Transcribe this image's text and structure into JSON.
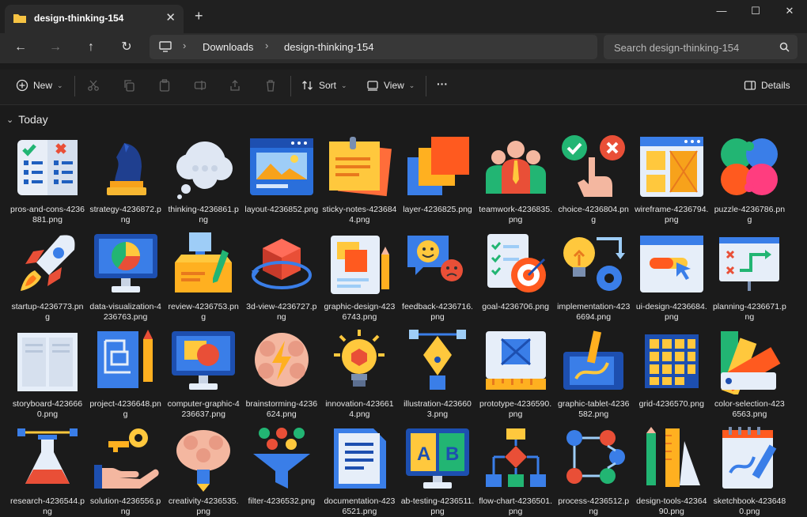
{
  "window": {
    "tab_title": "design-thinking-154",
    "minimize_glyph": "—",
    "maximize_glyph": "☐",
    "close_glyph": "✕"
  },
  "nav": {
    "breadcrumbs": [
      "Downloads",
      "design-thinking-154"
    ],
    "search_placeholder": "Search design-thinking-154"
  },
  "toolbar": {
    "new_label": "New",
    "sort_label": "Sort",
    "view_label": "View",
    "more_label": "···",
    "details_label": "Details"
  },
  "group_label": "Today",
  "files": [
    {
      "name": "pros-and-cons-4236881.png",
      "icon": "pros-cons-icon"
    },
    {
      "name": "strategy-4236872.png",
      "icon": "chess-knight-icon"
    },
    {
      "name": "thinking-4236861.png",
      "icon": "thought-cloud-icon"
    },
    {
      "name": "layout-4236852.png",
      "icon": "layout-window-icon"
    },
    {
      "name": "sticky-notes-4236844.png",
      "icon": "sticky-notes-icon"
    },
    {
      "name": "layer-4236825.png",
      "icon": "layers-icon"
    },
    {
      "name": "teamwork-4236835.png",
      "icon": "team-icon"
    },
    {
      "name": "choice-4236804.png",
      "icon": "choice-hand-icon"
    },
    {
      "name": "wireframe-4236794.png",
      "icon": "wireframe-icon"
    },
    {
      "name": "puzzle-4236786.png",
      "icon": "puzzle-brain-icon"
    },
    {
      "name": "startup-4236773.png",
      "icon": "rocket-icon"
    },
    {
      "name": "data-visualization-4236763.png",
      "icon": "pie-monitor-icon"
    },
    {
      "name": "review-4236753.png",
      "icon": "review-box-icon"
    },
    {
      "name": "3d-view-4236727.png",
      "icon": "cube-rotate-icon"
    },
    {
      "name": "graphic-design-4236743.png",
      "icon": "design-doc-icon"
    },
    {
      "name": "feedback-4236716.png",
      "icon": "feedback-faces-icon"
    },
    {
      "name": "goal-4236706.png",
      "icon": "goal-target-icon"
    },
    {
      "name": "implementation-4236694.png",
      "icon": "bulb-gear-icon"
    },
    {
      "name": "ui-design-4236684.png",
      "icon": "ui-design-icon"
    },
    {
      "name": "planning-4236671.png",
      "icon": "planning-board-icon"
    },
    {
      "name": "storyboard-4236660.png",
      "icon": "storyboard-icon"
    },
    {
      "name": "project-4236648.png",
      "icon": "blueprint-icon"
    },
    {
      "name": "computer-graphic-4236637.png",
      "icon": "computer-graphic-icon"
    },
    {
      "name": "brainstorming-4236624.png",
      "icon": "brain-bolt-icon"
    },
    {
      "name": "innovation-4236614.png",
      "icon": "innovation-bulb-icon"
    },
    {
      "name": "illustration-4236603.png",
      "icon": "pen-nib-icon"
    },
    {
      "name": "prototype-4236590.png",
      "icon": "prototype-icon"
    },
    {
      "name": "graphic-tablet-4236582.png",
      "icon": "graphic-tablet-icon"
    },
    {
      "name": "grid-4236570.png",
      "icon": "grid-icon"
    },
    {
      "name": "color-selection-4236563.png",
      "icon": "color-swatch-icon"
    },
    {
      "name": "research-4236544.png",
      "icon": "flask-vector-icon"
    },
    {
      "name": "solution-4236556.png",
      "icon": "key-hand-icon"
    },
    {
      "name": "creativity-4236535.png",
      "icon": "brain-pencil-icon"
    },
    {
      "name": "filter-4236532.png",
      "icon": "funnel-icon"
    },
    {
      "name": "documentation-4236521.png",
      "icon": "document-icon"
    },
    {
      "name": "ab-testing-4236511.png",
      "icon": "ab-test-icon"
    },
    {
      "name": "flow-chart-4236501.png",
      "icon": "flow-chart-icon"
    },
    {
      "name": "process-4236512.png",
      "icon": "process-icon"
    },
    {
      "name": "design-tools-4236490.png",
      "icon": "design-tools-icon"
    },
    {
      "name": "sketchbook-4236480.png",
      "icon": "sketchbook-icon"
    }
  ],
  "colors": {
    "background": "#1b1b1b",
    "tab": "#2c2c2c",
    "address_bar": "#383838",
    "folder": "#f6c343"
  }
}
